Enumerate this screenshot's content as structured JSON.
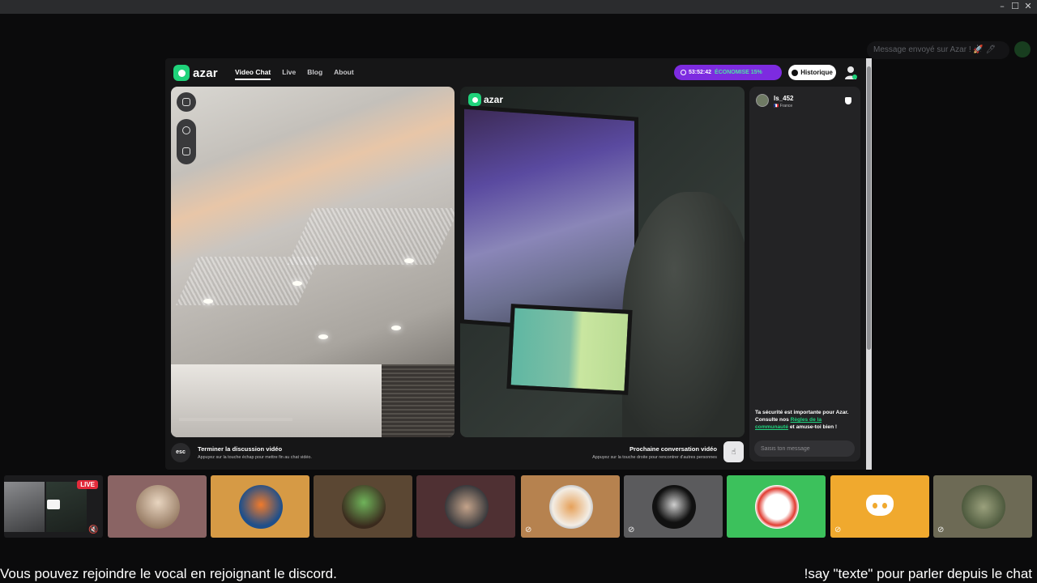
{
  "window": {
    "minimize": "–",
    "maximize": "☐",
    "close": "✕"
  },
  "notification": {
    "text": "Message envoyé sur Azar ! 🚀 🖊"
  },
  "azar": {
    "logo": "azar",
    "nav": [
      "Video Chat",
      "Live",
      "Blog",
      "About"
    ],
    "timer": "53:52:42",
    "promo": "ÉCONOMISE 15%",
    "history_label": "Historique",
    "watermark": "azar",
    "peer": {
      "name": "ls_452",
      "country": "🇫🇷 France"
    },
    "safety": {
      "text_before": "Ta sécurité est importante pour Azar. Consulte nos ",
      "link": "Règles de la communauté",
      "text_after": " et amuse-toi bien !"
    },
    "message_placeholder": "Saisis ton message",
    "esc_label": "esc",
    "end_title": "Terminer la discussion vidéo",
    "end_sub": "Appuyez sur la touche échap pour mettre fin au chat vidéo.",
    "next_title": "Prochaine conversation vidéo",
    "next_sub": "Appuyez sur la touche droite pour rencontrer d'autres personnes"
  },
  "participants": [
    {
      "name": "screen-share-live",
      "bg": "#1c1c1e",
      "live": "LIVE"
    },
    {
      "name": "participant-2",
      "bg": "#8a6464"
    },
    {
      "name": "participant-3",
      "bg": "#d69a45"
    },
    {
      "name": "participant-4",
      "bg": "#5b4733"
    },
    {
      "name": "participant-5",
      "bg": "#4f3033"
    },
    {
      "name": "participant-6",
      "bg": "#b6824f",
      "muted": true
    },
    {
      "name": "participant-7",
      "bg": "#5b5b5d",
      "muted": true
    },
    {
      "name": "participant-8",
      "bg": "#3cc15c"
    },
    {
      "name": "participant-discord",
      "bg": "#f0a92e",
      "muted": true
    },
    {
      "name": "participant-10",
      "bg": "#6d6a55",
      "muted": true
    }
  ],
  "captions": {
    "left": "Vous pouvez rejoindre le vocal en rejoignant le discord.",
    "right": "!say \"texte\" pour parler depuis le chat"
  }
}
